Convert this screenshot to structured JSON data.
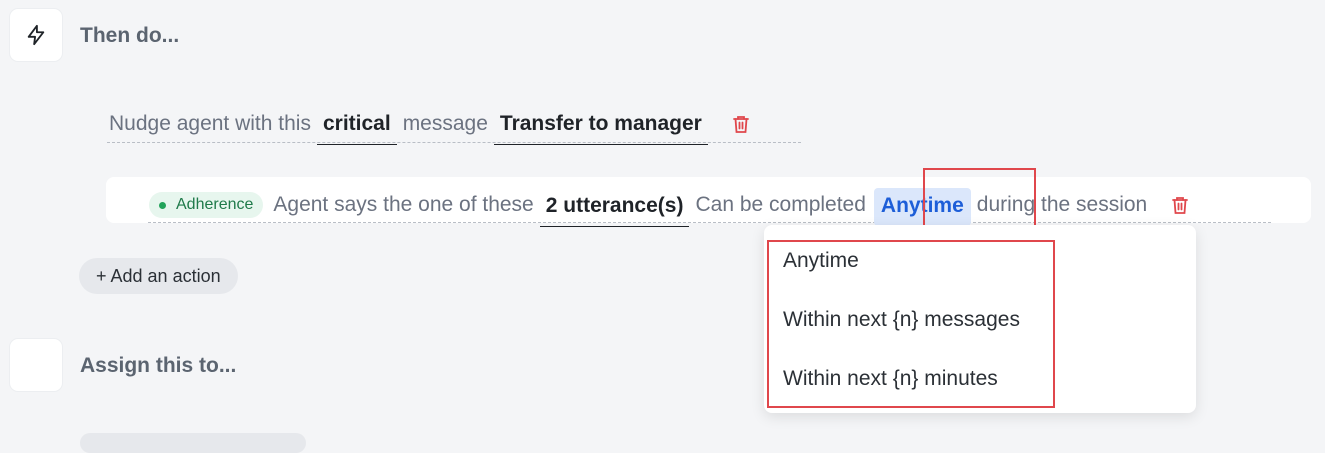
{
  "then_section": {
    "title": "Then do...",
    "icon": "lightning-icon"
  },
  "nudge_action": {
    "prefix": "Nudge agent with this",
    "severity": "critical",
    "middle": "message",
    "message": "Transfer to manager",
    "delete_icon": "trash-icon"
  },
  "adherence_action": {
    "badge": "Adherence",
    "text1": "Agent says the one of these",
    "utterances": "2 utterance(s)",
    "text2": "Can be completed",
    "timing": "Anytime",
    "text3": "during the session",
    "delete_icon": "trash-icon"
  },
  "add_action_button": "+ Add an action",
  "timing_dropdown": {
    "options": [
      "Anytime",
      "Within next {n} messages",
      "Within next {n} minutes"
    ]
  },
  "assign_section": {
    "title": "Assign this to..."
  },
  "colors": {
    "accent_blue": "#1d5ed8",
    "delete_red": "#e0474c",
    "highlight_red": "#e0474c",
    "badge_green": "#22a35a"
  }
}
